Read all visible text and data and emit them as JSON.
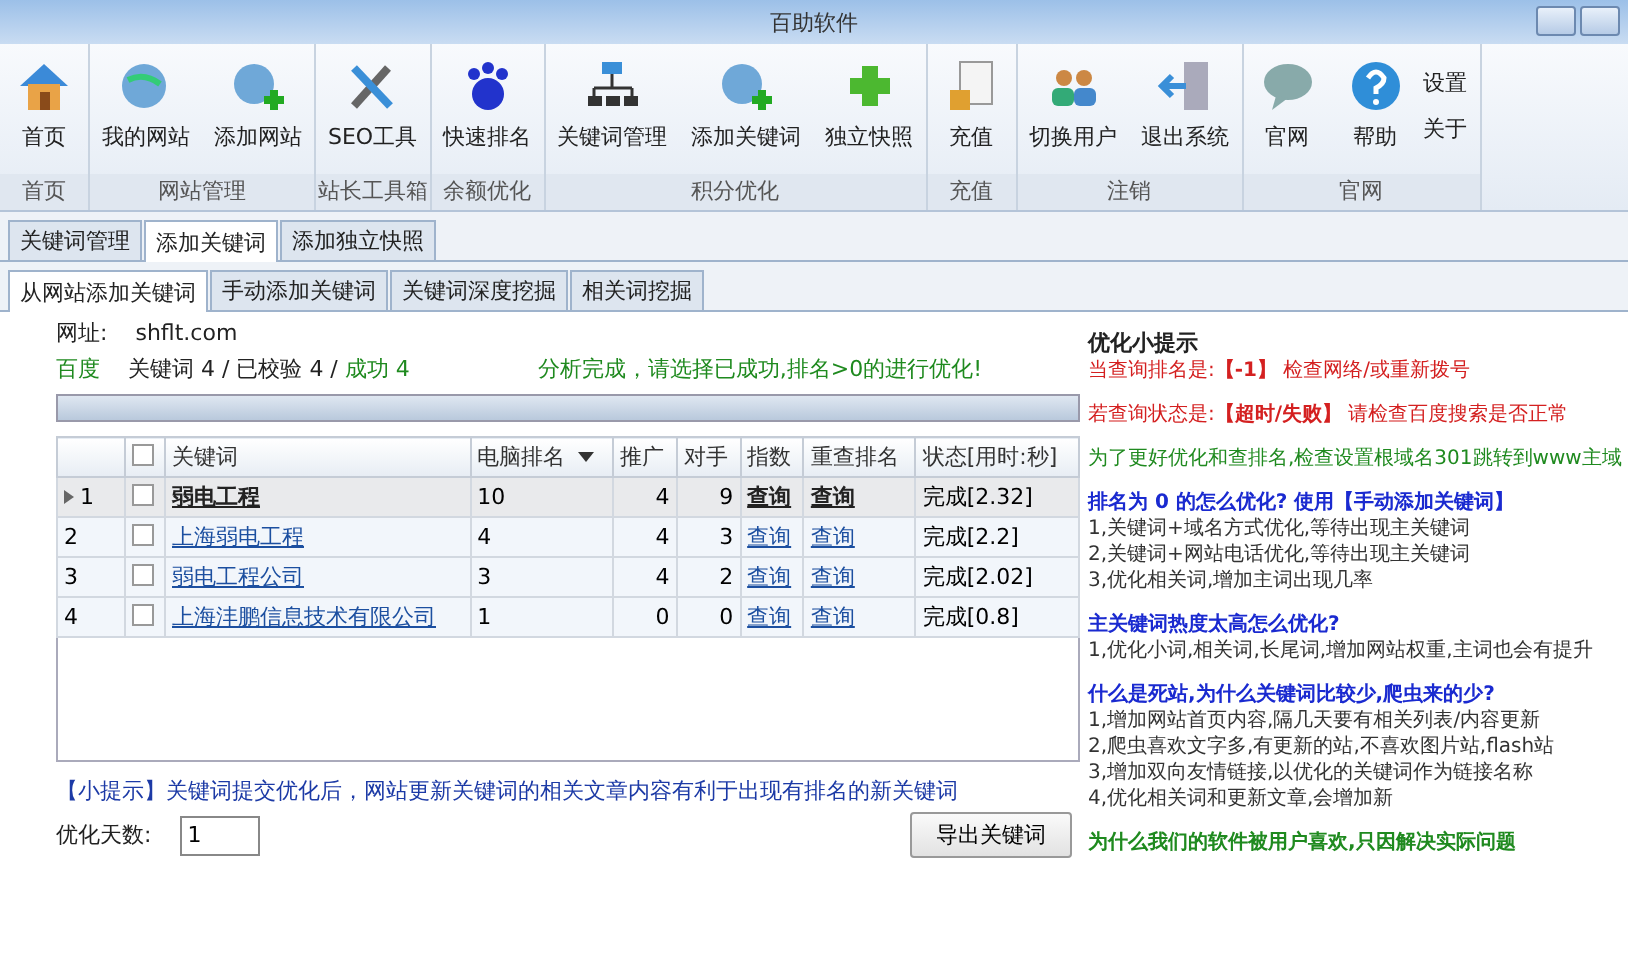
{
  "window": {
    "title": "百助软件"
  },
  "ribbon": {
    "groups": [
      {
        "label": "首页",
        "buttons": [
          "首页"
        ]
      },
      {
        "label": "网站管理",
        "buttons": [
          "我的网站",
          "添加网站"
        ]
      },
      {
        "label": "站长工具箱",
        "buttons": [
          "SEO工具"
        ]
      },
      {
        "label": "余额优化",
        "buttons": [
          "快速排名"
        ]
      },
      {
        "label": "积分优化",
        "buttons": [
          "关键词管理",
          "添加关键词",
          "独立快照"
        ]
      },
      {
        "label": "充值",
        "buttons": [
          "充值"
        ]
      },
      {
        "label": "注销",
        "buttons": [
          "切换用户",
          "退出系统"
        ]
      },
      {
        "label": "官网",
        "buttons": [
          "官网",
          "帮助"
        ],
        "side_links": [
          "设置",
          "关于"
        ]
      }
    ]
  },
  "tabs": [
    {
      "label": "关键词管理",
      "selected": false
    },
    {
      "label": "添加关键词",
      "selected": true
    },
    {
      "label": "添加独立快照",
      "selected": false
    }
  ],
  "subtabs": [
    {
      "label": "从网站添加关键词",
      "selected": true
    },
    {
      "label": "手动添加关键词",
      "selected": false
    },
    {
      "label": "关键词深度挖掘",
      "selected": false
    },
    {
      "label": "相关词挖掘",
      "selected": false
    }
  ],
  "site": {
    "label": "网址:",
    "value": "shflt.com"
  },
  "summary": {
    "engine": "百度",
    "keywords": "关键词 4 / 已校验 4 /",
    "success": "成功 4",
    "message": "分析完成，请选择已成功,排名>0的进行优化!"
  },
  "table": {
    "all_checked": false,
    "columns": [
      {
        "label": "关键词",
        "sorted": false
      },
      {
        "label": "电脑排名",
        "sorted": true
      },
      {
        "label": "推广",
        "sorted": false
      },
      {
        "label": "对手",
        "sorted": false
      },
      {
        "label": "指数",
        "sorted": false
      },
      {
        "label": "重查排名",
        "sorted": false
      },
      {
        "label": "状态[用时:秒]",
        "sorted": false
      }
    ],
    "rows": [
      {
        "num": "1",
        "selected": true,
        "checked": false,
        "cells": [
          "弱电工程",
          "10",
          "4",
          "9",
          "查询",
          "查询",
          "完成[2.32]"
        ]
      },
      {
        "num": "2",
        "selected": false,
        "checked": false,
        "cells": [
          "上海弱电工程",
          "4",
          "4",
          "3",
          "查询",
          "查询",
          "完成[2.2]"
        ]
      },
      {
        "num": "3",
        "selected": false,
        "checked": false,
        "cells": [
          "弱电工程公司",
          "3",
          "4",
          "2",
          "查询",
          "查询",
          "完成[2.02]"
        ]
      },
      {
        "num": "4",
        "selected": false,
        "checked": false,
        "cells": [
          "上海沣鹏信息技术有限公司",
          "1",
          "0",
          "0",
          "查询",
          "查询",
          "完成[0.8]"
        ]
      }
    ]
  },
  "hint": "【小提示】关键词提交优化后，网站更新关键词的相关文章内容有利于出现有排名的新关键词",
  "days": {
    "label": "优化天数:",
    "value": "1"
  },
  "export_button": "导出关键词",
  "tips": {
    "title": "优化小提示",
    "blocks": [
      {
        "kind": "alert",
        "lines": [
          "当查询排名是:**【-1】** 检查网络/或重新拨号"
        ]
      },
      {
        "kind": "alert",
        "lines": [
          "若查询状态是:**【超时/失败】** 请检查百度搜索是否正常"
        ]
      },
      {
        "kind": "note",
        "lines": [
          "为了更好优化和查排名,检查设置根域名301跳转到www主域"
        ]
      },
      {
        "kind": "faq",
        "lines": [
          "排名为 0 的怎么优化? 使用【手动添加关键词】",
          "1,关键词+域名方式优化,等待出现主关键词",
          "2,关键词+网站电话优化,等待出现主关键词",
          "3,优化相关词,增加主词出现几率"
        ]
      },
      {
        "kind": "faq",
        "lines": [
          "主关键词热度太高怎么优化?",
          "1,优化小词,相关词,长尾词,增加网站权重,主词也会有提升"
        ]
      },
      {
        "kind": "faq",
        "lines": [
          "什么是死站,为什么关键词比较少,爬虫来的少?",
          "1,增加网站首页内容,隔几天要有相关列表/内容更新",
          "2,爬虫喜欢文字多,有更新的站,不喜欢图片站,flash站",
          "3,增加双向友情链接,以优化的关键词作为链接名称",
          "4,优化相关词和更新文章,会增加新"
        ]
      },
      {
        "kind": "note",
        "lines": [
          "为什么我们的软件被用户喜欢,只因解决实际问题"
        ]
      }
    ]
  }
}
